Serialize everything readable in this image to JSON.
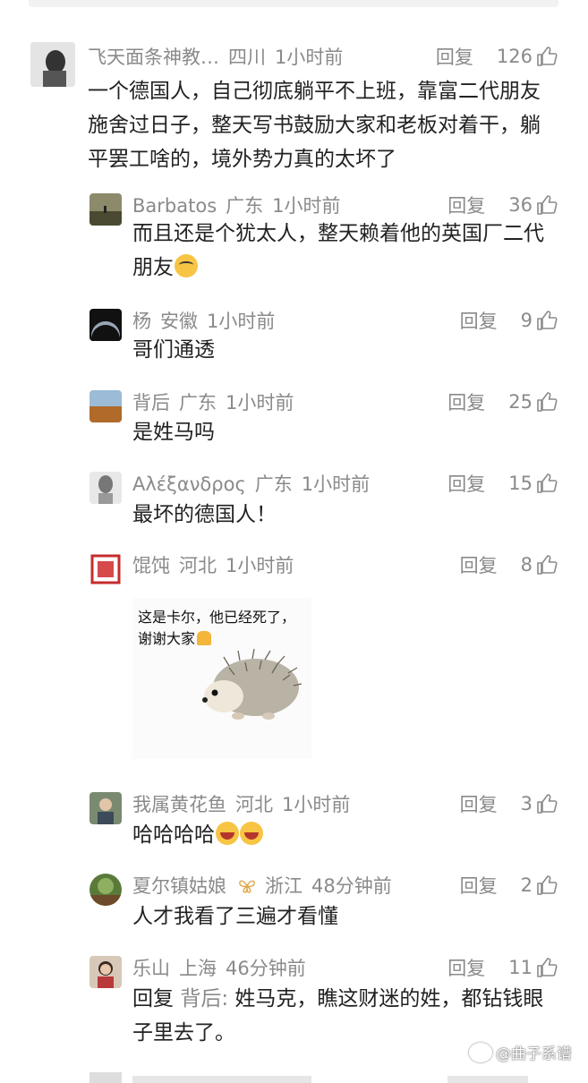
{
  "comments": [
    {
      "user": "飞天面条神教…",
      "location": "四川",
      "time": "1小时前",
      "reply_label": "回复",
      "likes": "126",
      "text": "一个德国人，自己彻底躺平不上班，靠富二代朋友施舍过日子，整天写书鼓励大家和老板对着干，躺平罢工啥的，境外势力真的太坏了"
    },
    {
      "user": "Barbatos",
      "location": "广东",
      "time": "1小时前",
      "reply_label": "回复",
      "likes": "36",
      "text": "而且还是个犹太人，整天赖着他的英国厂二代朋友"
    },
    {
      "user": "杨",
      "location": "安徽",
      "time": "1小时前",
      "reply_label": "回复",
      "likes": "9",
      "text": "哥们通透"
    },
    {
      "user": "背后",
      "location": "广东",
      "time": "1小时前",
      "reply_label": "回复",
      "likes": "25",
      "text": "是姓马吗"
    },
    {
      "user": "Αλέξανδρος",
      "location": "广东",
      "time": "1小时前",
      "reply_label": "回复",
      "likes": "15",
      "text": "最坏的德国人！"
    },
    {
      "user": "馄饨",
      "location": "河北",
      "time": "1小时前",
      "reply_label": "回复",
      "likes": "8",
      "sticker_text": "这是卡尔，他已经死了，谢谢大家"
    },
    {
      "user": "我属黄花鱼",
      "location": "河北",
      "time": "1小时前",
      "reply_label": "回复",
      "likes": "3",
      "text": "哈哈哈哈"
    },
    {
      "user": "夏尔镇姑娘",
      "location": "浙江",
      "time": "48分钟前",
      "reply_label": "回复",
      "likes": "2",
      "text": "人才我看了三遍才看懂"
    },
    {
      "user": "乐山",
      "location": "上海",
      "time": "46分钟前",
      "reply_label": "回复",
      "likes": "11",
      "reply_prefix": "回复",
      "reply_to": "背后:",
      "text": "姓马克，瞧这财迷的姓，都钻钱眼子里去了。"
    }
  ],
  "watermark": "@曲子系谱",
  "colors": {
    "meta_gray": "#8a8a8a",
    "text": "#222222",
    "background": "#ffffff"
  }
}
